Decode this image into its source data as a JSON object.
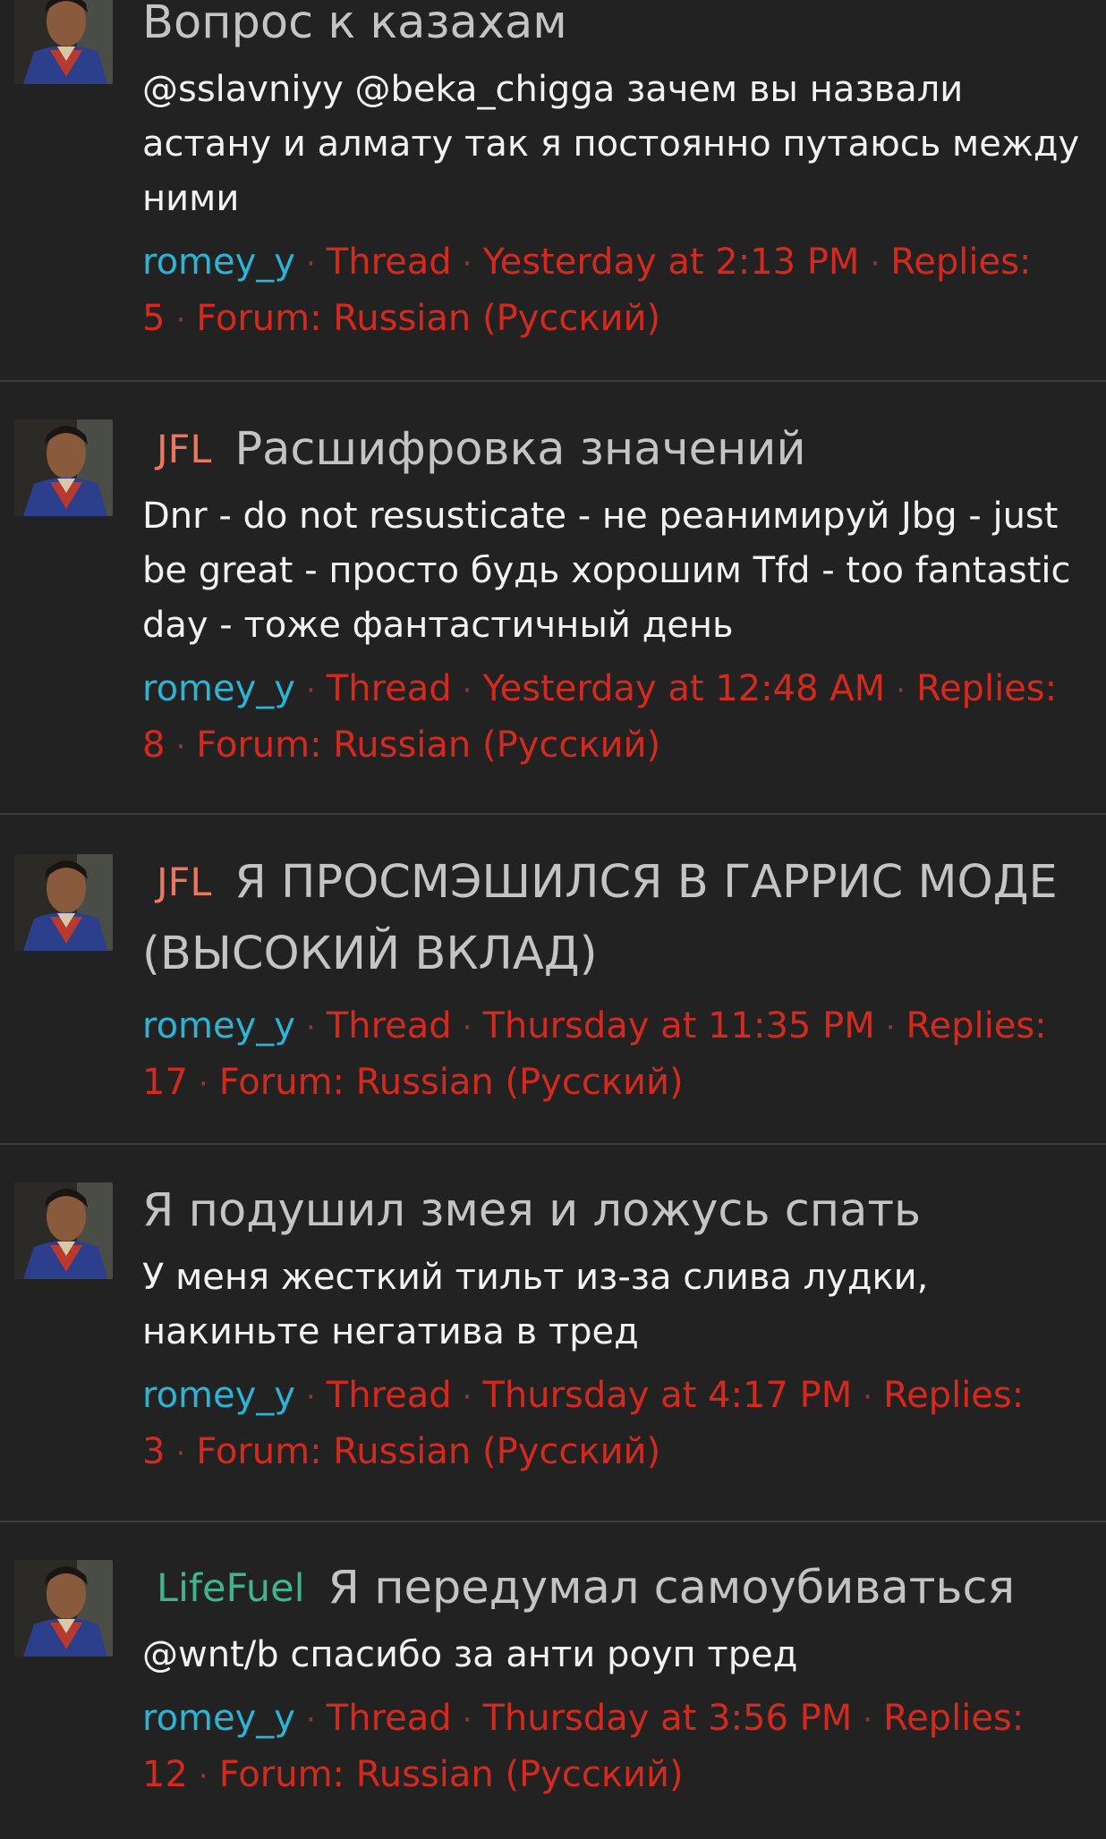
{
  "results": [
    {
      "prefix": "",
      "title": "Вопрос к казахам",
      "snippet": "@sslavniyy @beka_chigga зачем вы назвали астану и алмату так я постоянно путаюсь между ними",
      "author": "romey_y",
      "type": "Thread",
      "date": "Yesterday at 2:13 PM",
      "replies": "Replies: 5",
      "forum": "Forum: Russian (Русский)"
    },
    {
      "prefix": "JFL",
      "title": "Расшифровка значений",
      "snippet": "Dnr - do not resusticate - не реанимируй Jbg - just be great - просто будь хорошим Tfd - too fantastic day - тоже фантастичный день",
      "author": "romey_y",
      "type": "Thread",
      "date": "Yesterday at 12:48 AM",
      "replies": "Replies: 8",
      "forum": "Forum: Russian (Русский)"
    },
    {
      "prefix": "JFL",
      "title": "Я ПРОСМЭШИЛСЯ В ГАРРИС МОДЕ (ВЫСОКИЙ ВКЛАД)",
      "snippet": "",
      "author": "romey_y",
      "type": "Thread",
      "date": "Thursday at 11:35 PM",
      "replies": "Replies: 17",
      "forum": "Forum: Russian (Русский)"
    },
    {
      "prefix": "",
      "title": "Я подушил змея и ложусь спать",
      "snippet": "У меня жесткий тильт из-за слива лудки, накиньте негатива в тред",
      "author": "romey_y",
      "type": "Thread",
      "date": "Thursday at 4:17 PM",
      "replies": "Replies: 3",
      "forum": "Forum: Russian (Русский)"
    },
    {
      "prefix": "LifeFuel",
      "title": "Я передумал самоубиваться",
      "snippet": "@wnt/b спасибо за анти роуп тред",
      "author": "romey_y",
      "type": "Thread",
      "date": "Thursday at 3:56 PM",
      "replies": "Replies: 12",
      "forum": "Forum: Russian (Русский)"
    }
  ],
  "icons": {
    "avatar": "user-avatar"
  },
  "colors": {
    "background": "#222222",
    "divider": "#3c3c3c",
    "title": "#c4c4c4",
    "snippet": "#f2f2f2",
    "meta": "#d42a1e",
    "author": "#2ab4d6",
    "prefix_jfl": "#e8795f",
    "prefix_lifefuel": "#3fb48d"
  }
}
